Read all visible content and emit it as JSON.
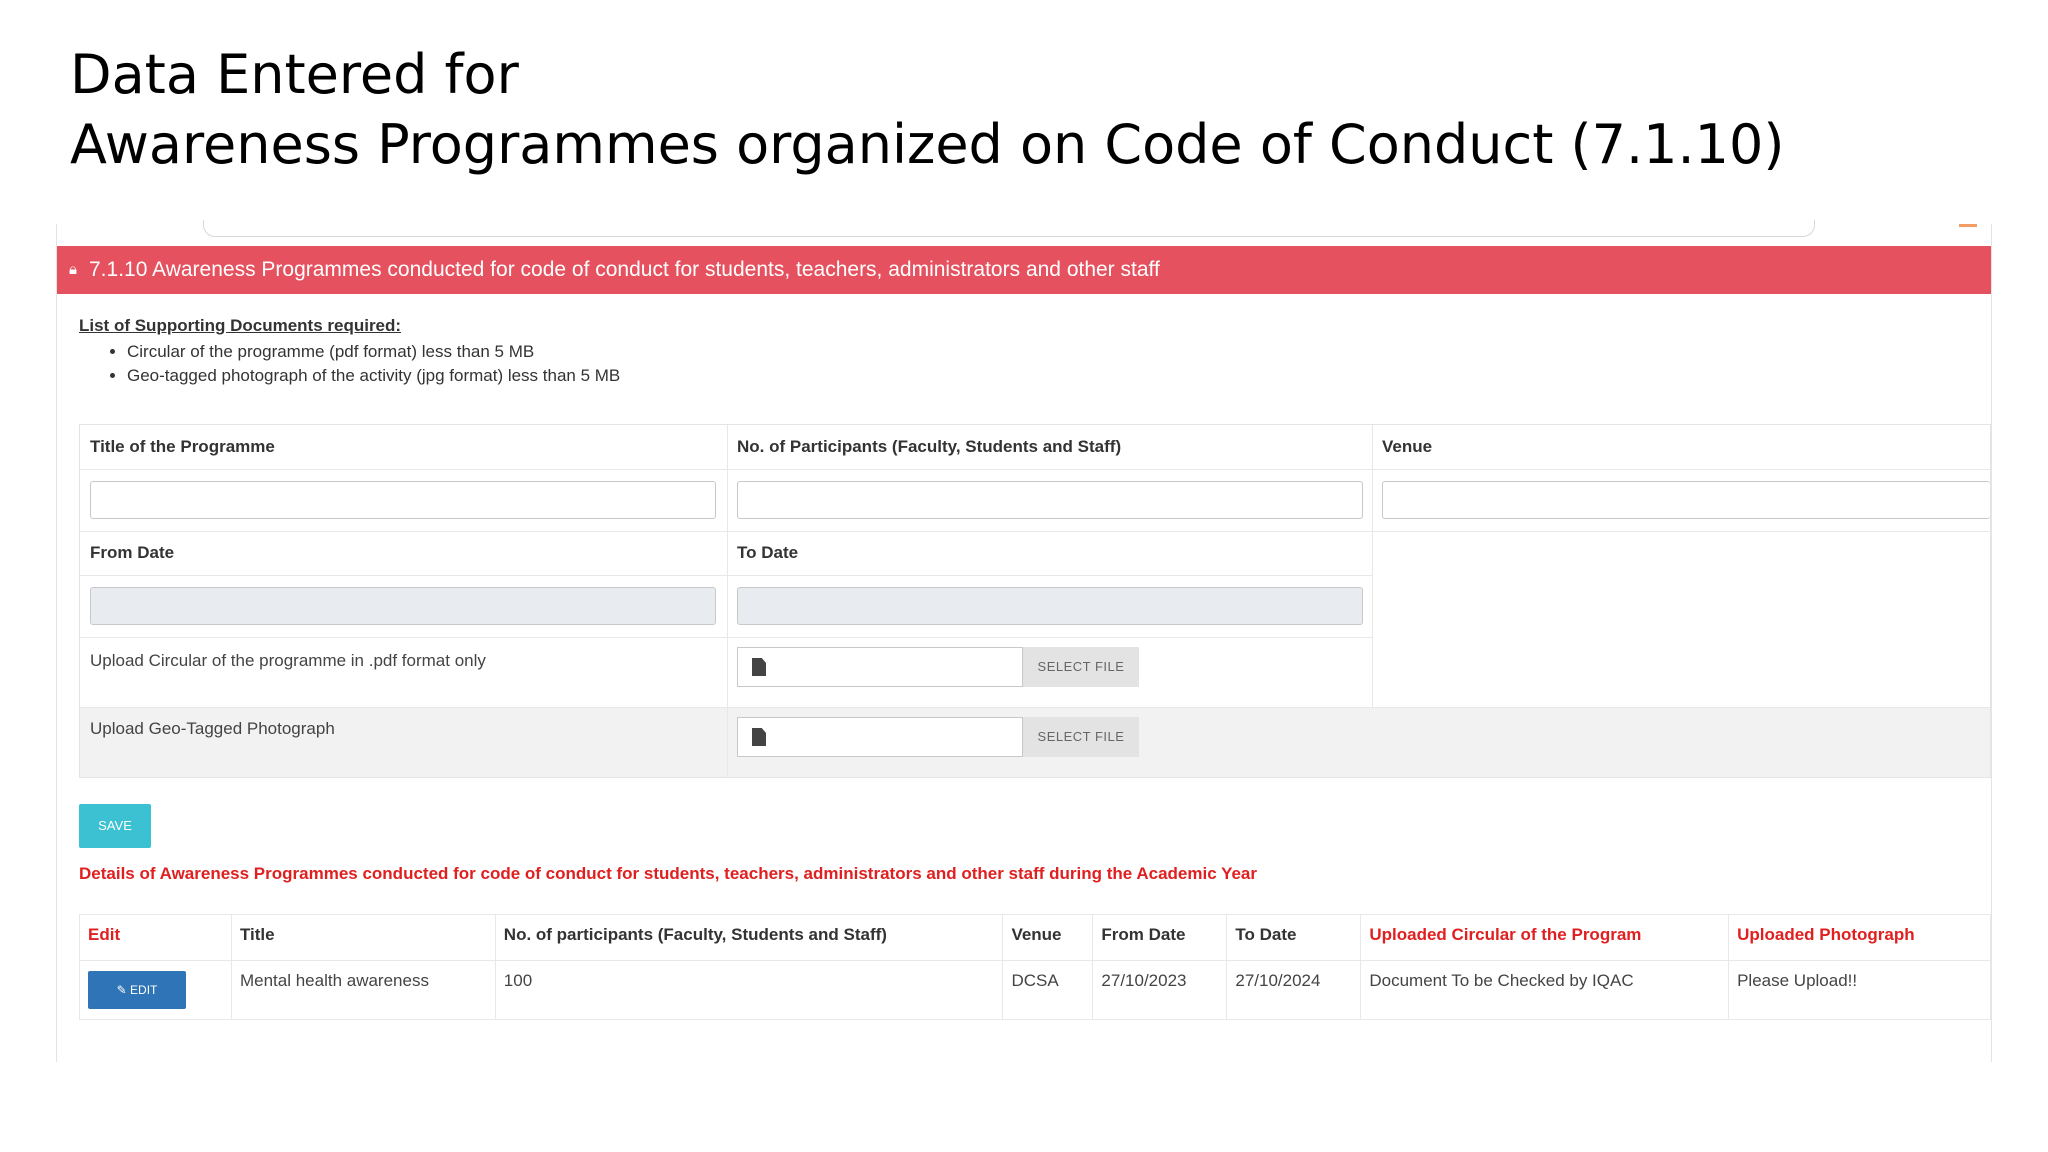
{
  "slide": {
    "title_line1": "Data Entered for",
    "title_line2": "Awareness Programmes organized on Code of Conduct (7.1.10)"
  },
  "panel": {
    "header_icon": "lock-icon",
    "header_title": "7.1.10 Awareness Programmes conducted for code of conduct for students, teachers, administrators and other staff",
    "header_color": "#e5515e"
  },
  "supporting_docs": {
    "title": "List of Supporting Documents required:",
    "items": [
      "Circular of the programme (pdf format) less than 5 MB",
      "Geo-tagged photograph of the activity (jpg format) less than 5 MB"
    ]
  },
  "form": {
    "title_label": "Title of the Programme",
    "participants_label": "No. of Participants (Faculty, Students and Staff)",
    "venue_label": "Venue",
    "from_date_label": "From Date",
    "to_date_label": "To Date",
    "title_value": "",
    "participants_value": "",
    "venue_value": "",
    "from_date_value": "",
    "to_date_value": "",
    "upload_circular_label": "Upload Circular of the programme in .pdf format only",
    "upload_photo_label": "Upload Geo-Tagged Photograph",
    "select_file_label": "SELECT FILE",
    "file_icon": "file-icon",
    "save_label": "SAVE",
    "save_color": "#3bc1d1"
  },
  "details": {
    "title": "Details of Awareness Programmes conducted for code of conduct for students, teachers, administrators and other staff during the Academic Year",
    "columns": [
      "Edit",
      "Title",
      "No. of participants (Faculty, Students and Staff)",
      "Venue",
      "From Date",
      "To Date",
      "Uploaded Circular of the Program",
      "Uploaded Photograph"
    ],
    "rows": [
      {
        "edit_label": "EDIT",
        "edit_icon": "pencil-icon",
        "title": "Mental health awareness",
        "participants": "100",
        "venue": "DCSA",
        "from_date": "27/10/2023",
        "to_date": "27/10/2024",
        "circular": "Document To be Checked by IQAC",
        "photograph": "Please Upload!!"
      }
    ]
  }
}
